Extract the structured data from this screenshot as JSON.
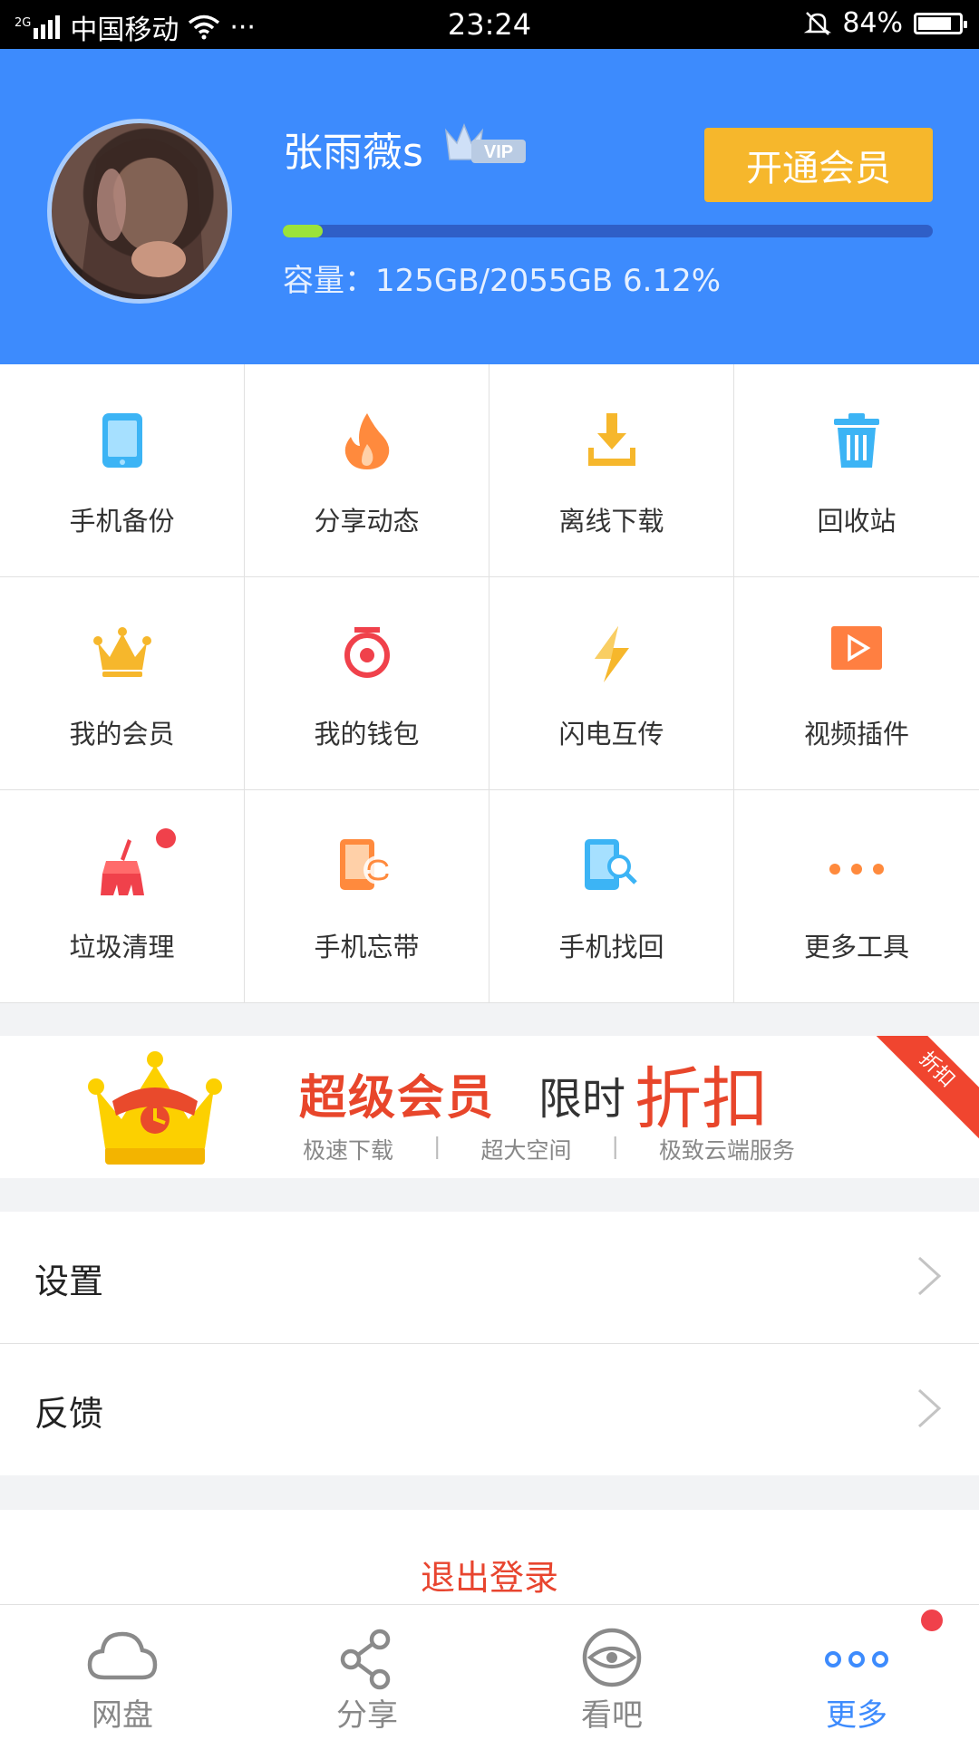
{
  "status_bar": {
    "network_type": "2G",
    "carrier": "中国移动",
    "more": "···",
    "time": "23:24",
    "battery_percent": "84%",
    "battery_level": 0.84
  },
  "profile": {
    "username": "张雨薇s",
    "vip_badge": "VIP",
    "upgrade_button": "开通会员",
    "capacity_text": "容量：125GB/2055GB 6.12%",
    "capacity_fraction": 0.0612,
    "colors": {
      "header": "#3d8bfd",
      "button": "#f6b72c",
      "progress_fill": "#9be33a"
    }
  },
  "tools": [
    {
      "label": "手机备份",
      "icon": "phone-backup-icon"
    },
    {
      "label": "分享动态",
      "icon": "flame-icon"
    },
    {
      "label": "离线下载",
      "icon": "download-icon"
    },
    {
      "label": "回收站",
      "icon": "trash-icon"
    },
    {
      "label": "我的会员",
      "icon": "crown-icon"
    },
    {
      "label": "我的钱包",
      "icon": "wallet-icon"
    },
    {
      "label": "闪电互传",
      "icon": "lightning-icon"
    },
    {
      "label": "视频插件",
      "icon": "video-play-icon"
    },
    {
      "label": "垃圾清理",
      "icon": "broom-icon",
      "badge": true
    },
    {
      "label": "手机忘带",
      "icon": "phone-sync-icon"
    },
    {
      "label": "手机找回",
      "icon": "phone-search-icon"
    },
    {
      "label": "更多工具",
      "icon": "more-dots-icon"
    }
  ],
  "promo": {
    "title": "超级会员",
    "limited": "限时",
    "discount": "折扣",
    "features": [
      "极速下载",
      "超大空间",
      "极致云端服务"
    ],
    "separator": "|",
    "ribbon": "折扣"
  },
  "menu": [
    {
      "label": "设置"
    },
    {
      "label": "反馈"
    }
  ],
  "logout": "退出登录",
  "tabbar": [
    {
      "label": "网盘",
      "icon": "cloud-icon",
      "active": false
    },
    {
      "label": "分享",
      "icon": "share-icon",
      "active": false
    },
    {
      "label": "看吧",
      "icon": "eye-icon",
      "active": false
    },
    {
      "label": "更多",
      "icon": "more-dots-icon",
      "active": true,
      "badge": true
    }
  ]
}
